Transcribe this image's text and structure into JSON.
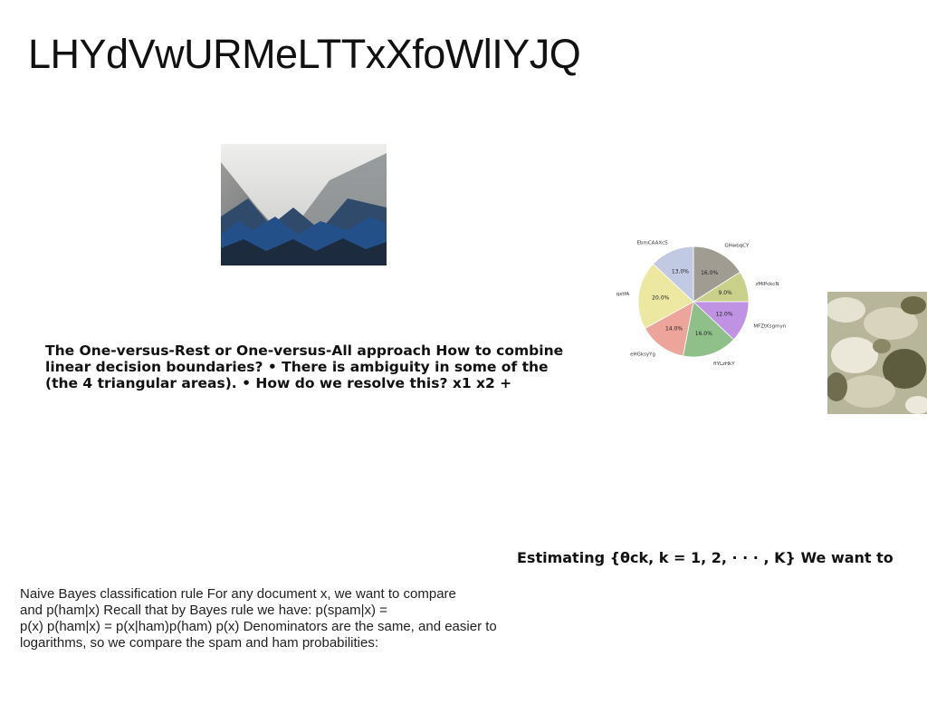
{
  "slide": {
    "title": "LHYdVwURMeLTTxXfoWlIYJQ",
    "text_block_1": [
      "The One-versus-Rest or One-versus-All approach How to combine",
      "linear decision boundaries? • There is ambiguity in some of the",
      "(the 4 triangular areas). • How do we resolve this? x1 x2 +"
    ],
    "text_block_2": "Estimating {θck, k = 1, 2, · · · , K} We want to",
    "text_block_3": [
      "Naive Bayes classification rule For any document x, we want to compare",
      "and p(ham|x) Recall that by Bayes rule we have: p(spam|x) =",
      "p(x) p(ham|x) = p(x|ham)p(ham) p(x) Denominators are the same, and easier to",
      "logarithms, so we compare the spam and ham probabilities:"
    ]
  },
  "chart_data": {
    "type": "pie",
    "title": "",
    "start_angle_deg": 90,
    "direction": "clockwise",
    "slices": [
      {
        "label": "GHwbqCY",
        "value": 16.0,
        "pct_label": "16.0%",
        "color": "#a09c92"
      },
      {
        "label": "zMIPckcN",
        "value": 9.0,
        "pct_label": "9.0%",
        "color": "#c8d08a"
      },
      {
        "label": "MFZtKsgmyn",
        "value": 12.0,
        "pct_label": "12.0%",
        "color": "#bf92e4"
      },
      {
        "label": "fIYLzHkY",
        "value": 16.0,
        "pct_label": "16.0%",
        "color": "#8fc08a"
      },
      {
        "label": "eHGksyYg",
        "value": 14.0,
        "pct_label": "14.0%",
        "color": "#eda49a"
      },
      {
        "label": "qxtfA",
        "value": 20.0,
        "pct_label": "20.0%",
        "color": "#ece8a2"
      },
      {
        "label": "EbmCAAXcS",
        "value": 13.0,
        "pct_label": "13.0%",
        "color": "#c2c9e3"
      }
    ]
  }
}
